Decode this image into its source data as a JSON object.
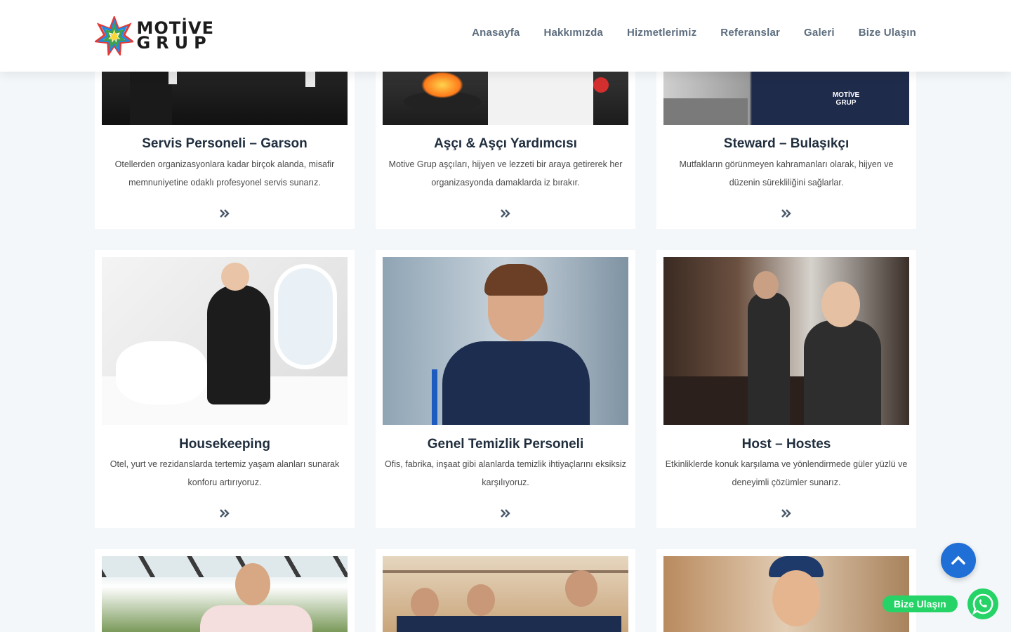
{
  "brand": {
    "line1": "MOTİVE",
    "line2": "GRUP"
  },
  "nav": [
    {
      "label": "Anasayfa"
    },
    {
      "label": "Hakkımızda"
    },
    {
      "label": "Hizmetlerimiz"
    },
    {
      "label": "Referanslar"
    },
    {
      "label": "Galeri"
    },
    {
      "label": "Bize Ulaşın"
    }
  ],
  "services": [
    {
      "title": "Servis Personeli – Garson",
      "desc": "Otellerden organizasyonlara kadar birçok alanda, misafir memnuniyetine odaklı profesyonel servis sunarız.",
      "image": "waiters-team-photo"
    },
    {
      "title": "Aşçı & Aşçı Yardımcısı",
      "desc": "Motive Grup aşçıları, hijyen ve lezzeti bir araya getirerek her organizasyonda damaklarda iz bırakır.",
      "image": "chef-cooking-photo"
    },
    {
      "title": "Steward – Bulaşıkçı",
      "desc": "Mutfakların görünmeyen kahramanları olarak, hijyen ve düzenin sürekliliğini sağlarlar.",
      "image": "steward-uniform-photo"
    },
    {
      "title": "Housekeeping",
      "desc": "Otel, yurt ve rezidanslarda tertemiz yaşam alanları sunarak konforu artırıyoruz.",
      "image": "housekeeper-bed-photo"
    },
    {
      "title": "Genel Temizlik Personeli",
      "desc": "Ofis, fabrika, inşaat gibi alanlarda temizlik ihtiyaçlarını eksiksiz karşılıyoruz.",
      "image": "cleaner-airport-photo"
    },
    {
      "title": "Host – Hostes",
      "desc": "Etkinliklerde konuk karşılama ve yönlendirmede güler yüzlü ve deneyimli çözümler sunarız.",
      "image": "host-hostess-photo"
    },
    {
      "title": "",
      "desc": "",
      "image": "bartender-photo"
    },
    {
      "title": "",
      "desc": "",
      "image": "warehouse-team-photo"
    },
    {
      "title": "",
      "desc": "",
      "image": "warehouse-worker-photo"
    }
  ],
  "whatsapp": {
    "label": "Bize Ulaşın"
  },
  "colors": {
    "accent": "#1f6fd6",
    "whatsapp": "#25d366",
    "nav": "#5d6d7e",
    "background": "#f3f7fa"
  }
}
